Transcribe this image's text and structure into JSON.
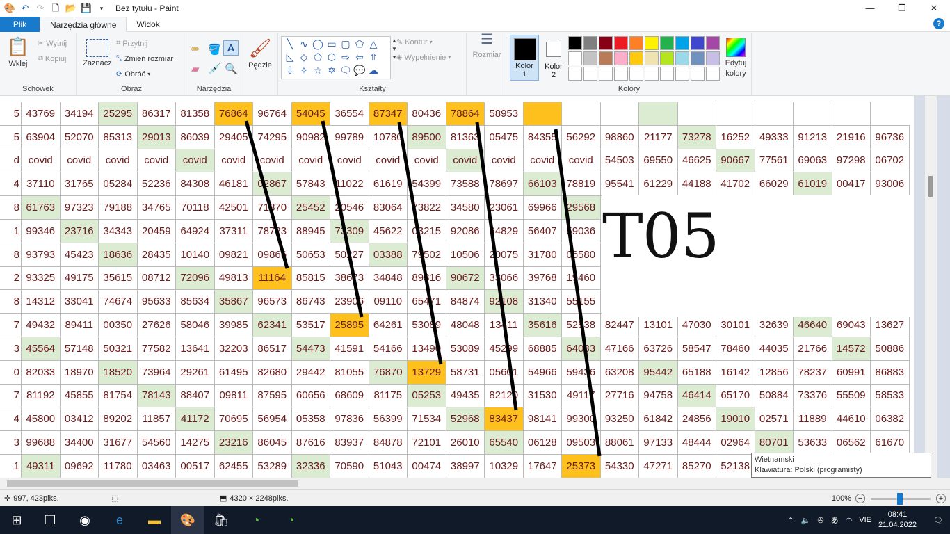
{
  "app": {
    "title": "Bez tytułu - Paint"
  },
  "quick_access": {
    "icons": [
      "paint-app-icon",
      "undo-icon",
      "redo-icon",
      "new-file-icon",
      "open-file-icon",
      "save-icon",
      "customize-icon"
    ]
  },
  "window_controls": {
    "minimize": "—",
    "maximize": "❐",
    "close": "✕"
  },
  "tabs": [
    {
      "label": "Plik"
    },
    {
      "label": "Narzędzia główne"
    },
    {
      "label": "Widok"
    }
  ],
  "help": "?",
  "ribbon": {
    "schowek": {
      "label": "Schowek",
      "paste": "Wklej",
      "cut": "Wytnij",
      "copy": "Kopiuj"
    },
    "obraz": {
      "label": "Obraz",
      "select": "Zaznacz",
      "crop": "Przytnij",
      "resize": "Zmień rozmiar",
      "rotate": "Obróć"
    },
    "narzedzia": {
      "label": "Narzędzia"
    },
    "pedzle": {
      "label": "Pędzle"
    },
    "ksztalty": {
      "label": "Kształty",
      "outline": "Kontur",
      "fill": "Wypełnienie"
    },
    "rozmiar": {
      "label": "Rozmiar"
    },
    "kolory": {
      "label": "Kolory",
      "color1": "Kolor",
      "color1_n": "1",
      "color2": "Kolor",
      "color2_n": "2",
      "edit": "Edytuj",
      "edit2": "kolory"
    },
    "palette": [
      "#000000",
      "#7f7f7f",
      "#880015",
      "#ed1c24",
      "#ff7f27",
      "#fff200",
      "#22b14c",
      "#00a2e8",
      "#3f48cc",
      "#a349a4",
      "#ffffff",
      "#c3c3c3",
      "#b97a57",
      "#ffaec9",
      "#ffc90e",
      "#efe4b0",
      "#b5e61d",
      "#99d9ea",
      "#7092be",
      "#c8bfe7",
      "#ffffff",
      "#ffffff",
      "#ffffff",
      "#ffffff",
      "#ffffff",
      "#ffffff",
      "#ffffff",
      "#ffffff",
      "#ffffff",
      "#ffffff"
    ]
  },
  "canvas": {
    "overlay_text": "T05",
    "first_col": [
      "5",
      "5",
      "d",
      "4",
      "8",
      "1",
      "8",
      "2",
      "8",
      "7",
      "3",
      "0",
      "7",
      "4",
      "3",
      "1"
    ],
    "rows": [
      [
        "43769",
        "34194",
        "25295",
        "86317",
        "81358",
        "76864",
        "96764",
        "54045",
        "36554",
        "87347",
        "80436",
        "78864",
        "58953",
        "",
        "",
        "",
        "",
        "",
        "",
        "",
        "",
        ""
      ],
      [
        "63904",
        "52070",
        "85313",
        "29013",
        "86039",
        "29405",
        "74295",
        "90982",
        "99789",
        "10780",
        "89500",
        "81363",
        "05475",
        "84355",
        "56292",
        "98860",
        "21177",
        "73278",
        "16252",
        "49333",
        "91213",
        "21916",
        "96736"
      ],
      [
        "covid",
        "covid",
        "covid",
        "covid",
        "covid",
        "covid",
        "covid",
        "covid",
        "covid",
        "covid",
        "covid",
        "covid",
        "covid",
        "covid",
        "covid",
        "54503",
        "69550",
        "46625",
        "90667",
        "77561",
        "69063",
        "97298",
        "06702"
      ],
      [
        "37110",
        "31765",
        "05284",
        "52236",
        "84308",
        "46181",
        "02867",
        "57843",
        "11022",
        "61619",
        "54399",
        "73588",
        "78697",
        "66103",
        "78819",
        "95541",
        "61229",
        "44188",
        "41702",
        "66029",
        "61019",
        "00417",
        "93006"
      ],
      [
        "61763",
        "97323",
        "79188",
        "34765",
        "70118",
        "42501",
        "71370",
        "25452",
        "20546",
        "83064",
        "73822",
        "34580",
        "23061",
        "69966",
        "29568"
      ],
      [
        "99346",
        "23716",
        "34343",
        "20459",
        "64924",
        "37311",
        "78723",
        "88945",
        "73309",
        "45622",
        "03215",
        "92086",
        "64829",
        "56407",
        "59036"
      ],
      [
        "93793",
        "45423",
        "18636",
        "28435",
        "10140",
        "09821",
        "09866",
        "50653",
        "50227",
        "03388",
        "79502",
        "10506",
        "20075",
        "31780",
        "06580"
      ],
      [
        "93325",
        "49175",
        "35615",
        "08712",
        "72096",
        "49813",
        "11164",
        "85815",
        "38673",
        "34848",
        "89316",
        "90672",
        "33066",
        "39768",
        "19460"
      ],
      [
        "14312",
        "33041",
        "74674",
        "95633",
        "85634",
        "35867",
        "96573",
        "86743",
        "23906",
        "09110",
        "65471",
        "84874",
        "92108",
        "31340",
        "55155"
      ],
      [
        "49432",
        "89411",
        "00350",
        "27626",
        "58046",
        "39985",
        "62341",
        "53517",
        "25895",
        "64261",
        "53089",
        "48048",
        "13411",
        "35616",
        "52538",
        "82447",
        "13101",
        "47030",
        "30101",
        "32639",
        "46640",
        "69043",
        "13627"
      ],
      [
        "45564",
        "57148",
        "50321",
        "77582",
        "13641",
        "32203",
        "86517",
        "54473",
        "41591",
        "54166",
        "13490",
        "53089",
        "45299",
        "68885",
        "64083",
        "47166",
        "63726",
        "58547",
        "78460",
        "44035",
        "21766",
        "14572",
        "50886"
      ],
      [
        "82033",
        "18970",
        "18520",
        "73964",
        "29261",
        "61495",
        "82680",
        "29442",
        "81055",
        "76870",
        "13729",
        "58731",
        "05601",
        "54966",
        "59436",
        "63208",
        "95442",
        "65188",
        "16142",
        "12856",
        "78237",
        "60991",
        "86883"
      ],
      [
        "81192",
        "45855",
        "81754",
        "78143",
        "88407",
        "09811",
        "87595",
        "60656",
        "68609",
        "81175",
        "05253",
        "49435",
        "82120",
        "31530",
        "49117",
        "27716",
        "94758",
        "46414",
        "65170",
        "50884",
        "73376",
        "55509",
        "58533"
      ],
      [
        "45800",
        "03412",
        "89202",
        "11857",
        "41172",
        "70695",
        "56954",
        "05358",
        "97836",
        "56399",
        "71534",
        "52968",
        "83437",
        "98141",
        "99300",
        "93250",
        "61842",
        "24856",
        "19010",
        "02571",
        "11889",
        "44610",
        "06382"
      ],
      [
        "99688",
        "34400",
        "31677",
        "54560",
        "14275",
        "23216",
        "86045",
        "87616",
        "83937",
        "84878",
        "72101",
        "26010",
        "65540",
        "06128",
        "09503",
        "88061",
        "97133",
        "48444",
        "02964",
        "80701",
        "53633",
        "06562",
        "61670"
      ],
      [
        "49311",
        "09692",
        "11780",
        "03463",
        "00517",
        "62455",
        "53289",
        "32336",
        "70590",
        "51043",
        "00474",
        "38997",
        "10329",
        "17647",
        "25373",
        "54330",
        "47271",
        "85270",
        "52138",
        "",
        "",
        "",
        ""
      ]
    ],
    "highlights": [
      {
        "r": 0,
        "c": 5,
        "t": "o"
      },
      {
        "r": 0,
        "c": 7,
        "t": "o"
      },
      {
        "r": 0,
        "c": 9,
        "t": "o"
      },
      {
        "r": 0,
        "c": 11,
        "t": "o"
      },
      {
        "r": 0,
        "c": 13,
        "t": "o"
      },
      {
        "r": 0,
        "c": 2,
        "t": "g"
      },
      {
        "r": 0,
        "c": 16,
        "t": "g"
      },
      {
        "r": 1,
        "c": 3,
        "t": "g"
      },
      {
        "r": 1,
        "c": 10,
        "t": "g"
      },
      {
        "r": 1,
        "c": 17,
        "t": "g"
      },
      {
        "r": 2,
        "c": 4,
        "t": "g"
      },
      {
        "r": 2,
        "c": 11,
        "t": "g"
      },
      {
        "r": 2,
        "c": 18,
        "t": "g"
      },
      {
        "r": 3,
        "c": 6,
        "t": "g"
      },
      {
        "r": 3,
        "c": 13,
        "t": "g"
      },
      {
        "r": 3,
        "c": 20,
        "t": "g"
      },
      {
        "r": 4,
        "c": 0,
        "t": "g"
      },
      {
        "r": 4,
        "c": 7,
        "t": "g"
      },
      {
        "r": 4,
        "c": 14,
        "t": "g"
      },
      {
        "r": 5,
        "c": 1,
        "t": "g"
      },
      {
        "r": 5,
        "c": 8,
        "t": "g"
      },
      {
        "r": 6,
        "c": 2,
        "t": "g"
      },
      {
        "r": 6,
        "c": 9,
        "t": "g"
      },
      {
        "r": 7,
        "c": 6,
        "t": "o"
      },
      {
        "r": 7,
        "c": 4,
        "t": "g"
      },
      {
        "r": 7,
        "c": 11,
        "t": "g"
      },
      {
        "r": 8,
        "c": 5,
        "t": "g"
      },
      {
        "r": 8,
        "c": 12,
        "t": "g"
      },
      {
        "r": 9,
        "c": 8,
        "t": "o"
      },
      {
        "r": 9,
        "c": 6,
        "t": "g"
      },
      {
        "r": 9,
        "c": 13,
        "t": "g"
      },
      {
        "r": 9,
        "c": 20,
        "t": "g"
      },
      {
        "r": 10,
        "c": 0,
        "t": "g"
      },
      {
        "r": 10,
        "c": 7,
        "t": "g"
      },
      {
        "r": 10,
        "c": 14,
        "t": "g"
      },
      {
        "r": 10,
        "c": 21,
        "t": "g"
      },
      {
        "r": 11,
        "c": 10,
        "t": "o"
      },
      {
        "r": 11,
        "c": 2,
        "t": "g"
      },
      {
        "r": 11,
        "c": 9,
        "t": "g"
      },
      {
        "r": 11,
        "c": 16,
        "t": "g"
      },
      {
        "r": 12,
        "c": 3,
        "t": "g"
      },
      {
        "r": 12,
        "c": 10,
        "t": "g"
      },
      {
        "r": 12,
        "c": 17,
        "t": "g"
      },
      {
        "r": 13,
        "c": 12,
        "t": "o"
      },
      {
        "r": 13,
        "c": 4,
        "t": "g"
      },
      {
        "r": 13,
        "c": 11,
        "t": "g"
      },
      {
        "r": 13,
        "c": 18,
        "t": "g"
      },
      {
        "r": 14,
        "c": 5,
        "t": "g"
      },
      {
        "r": 14,
        "c": 12,
        "t": "g"
      },
      {
        "r": 14,
        "c": 19,
        "t": "g"
      },
      {
        "r": 15,
        "c": 14,
        "t": "o"
      },
      {
        "r": 15,
        "c": 7,
        "t": "g"
      },
      {
        "r": 15,
        "c": 0,
        "t": "g"
      }
    ]
  },
  "tooltip": {
    "line1": "Wietnamski",
    "line2": "Klawiatura: Polski (programisty)"
  },
  "status": {
    "cursor": "997, 423piks.",
    "selection": "",
    "size": "4320 × 2248piks.",
    "zoom": "100%",
    "zoom_out": "−",
    "zoom_in": "+"
  },
  "taskbar": {
    "time": "08:41",
    "date": "21.04.2022",
    "lang": "VIE"
  }
}
